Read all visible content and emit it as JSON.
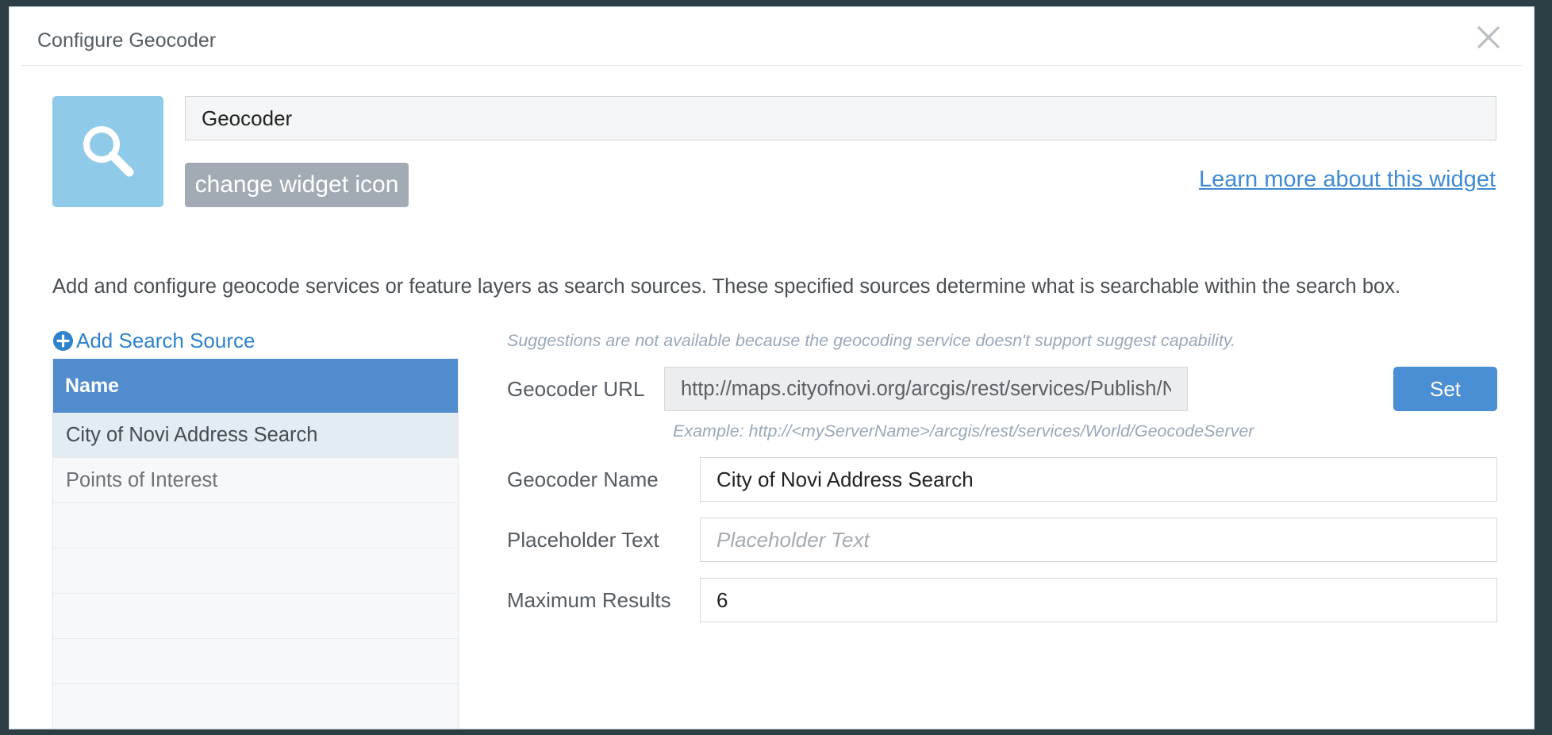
{
  "dialog": {
    "title": "Configure Geocoder"
  },
  "widget": {
    "name_value": "Geocoder",
    "change_icon_label": "change widget icon",
    "learn_more_label": "Learn more about this widget",
    "icon": "search-icon"
  },
  "description": "Add and configure geocode services or feature layers as search sources. These specified sources determine what is searchable within the search box.",
  "sources": {
    "add_label": "Add Search Source",
    "header": "Name",
    "rows": [
      "City of Novi Address Search",
      "Points of Interest"
    ]
  },
  "config": {
    "suggest_note": "Suggestions are not available because the geocoding service doesn't support suggest capability.",
    "url_label": "Geocoder URL",
    "url_value": "http://maps.cityofnovi.org/arcgis/rest/services/Publish/NoviCompositeLocator/GeocodeServer",
    "set_label": "Set",
    "url_example": "Example: http://<myServerName>/arcgis/rest/services/World/GeocodeServer",
    "name_label": "Geocoder Name",
    "name_value": "City of Novi Address Search",
    "placeholder_label": "Placeholder Text",
    "placeholder_hint": "Placeholder Text",
    "max_label": "Maximum Results",
    "max_value": "6"
  },
  "colors": {
    "accent": "#518ccd",
    "link": "#3f8bd3",
    "icon_bg": "#8fcbe8"
  }
}
